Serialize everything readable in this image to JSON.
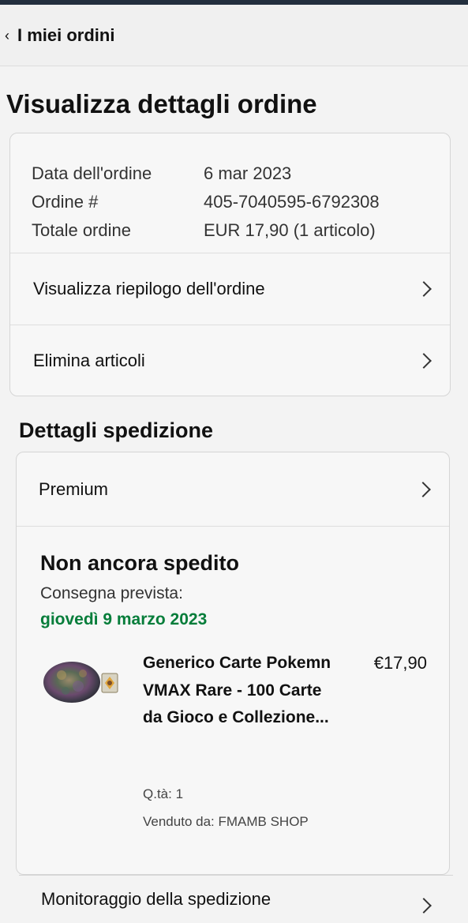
{
  "nav": {
    "back_label": "I miei ordini"
  },
  "page_title": "Visualizza dettagli ordine",
  "order": {
    "rows": [
      {
        "label": "Data dell'ordine",
        "value": "6 mar 2023"
      },
      {
        "label": "Ordine #",
        "value": "405-7040595-6792308"
      },
      {
        "label": "Totale ordine",
        "value": "EUR 17,90 (1 articolo)"
      }
    ],
    "summary_link": "Visualizza riepilogo dell'ordine",
    "remove_link": "Elimina articoli"
  },
  "shipping": {
    "heading": "Dettagli spedizione",
    "service": "Premium",
    "status": "Non ancora spedito",
    "delivery_label": "Consegna prevista:",
    "delivery_date": "giovedì 9 marzo 2023",
    "item": {
      "title": "Generico Carte Pokemn VMAX Rare - 100 Carte da Gioco e Collezione...",
      "price": "€17,90",
      "quantity": "Q.tà: 1",
      "seller": "Venduto da: FMAMB SHOP"
    },
    "tracking_link": "Monitoraggio della spedizione"
  },
  "colors": {
    "delivery_green": "#067d3a",
    "header_dark": "#232f3e"
  }
}
